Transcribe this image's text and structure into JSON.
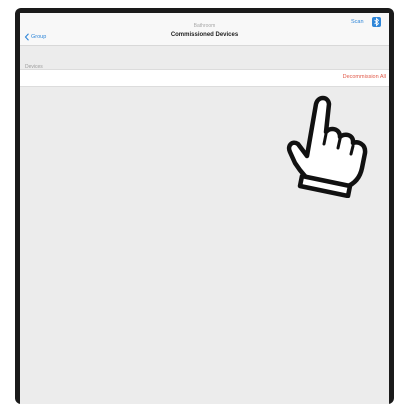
{
  "navbar": {
    "subtitle": "Bathroom",
    "title": "Commissioned Devices",
    "back_label": "Group",
    "scan_label": "Scan"
  },
  "section": {
    "header": "Devices"
  },
  "actions": {
    "decommission_all": "Decommission All"
  },
  "icons": {
    "back": "chevron-left-icon",
    "bluetooth": "bluetooth-icon",
    "pointer": "pointing-hand-icon"
  },
  "colors": {
    "accent": "#2f86d8",
    "destructive": "#e15a4a",
    "background": "#ececec",
    "frame": "#1a1a1a"
  }
}
